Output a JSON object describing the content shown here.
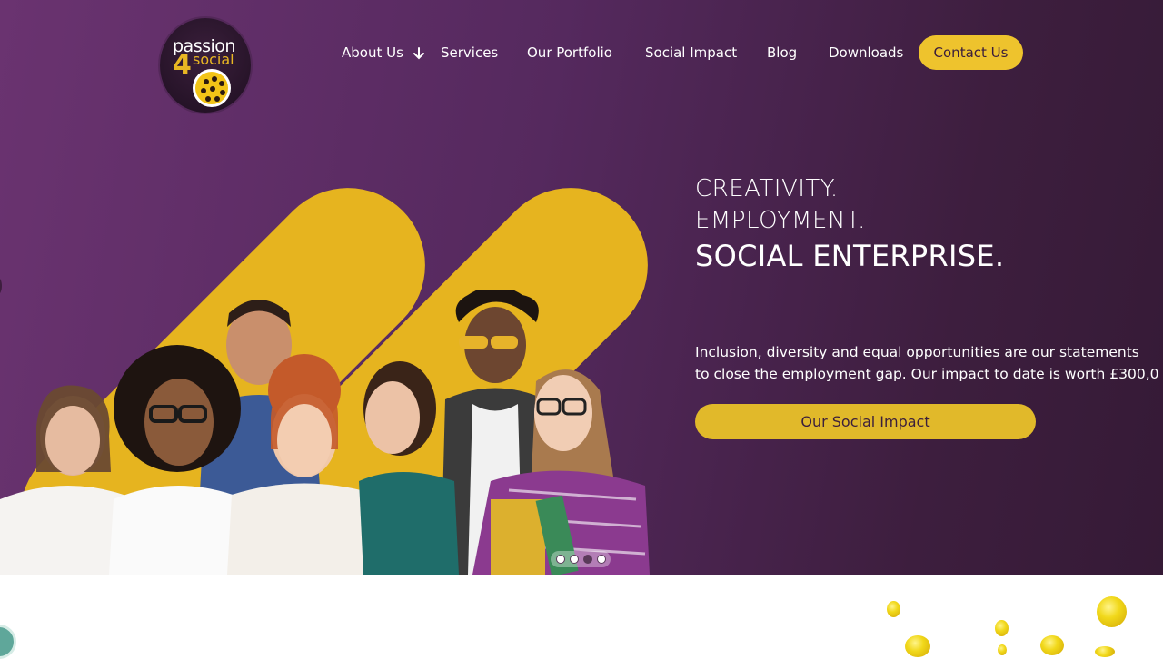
{
  "brand": {
    "logo_line1": "passion",
    "logo_number": "4",
    "logo_line2": "social"
  },
  "nav": {
    "items": [
      "About Us",
      "Services",
      "Our Portfolio",
      "Social Impact",
      "Blog",
      "Downloads"
    ],
    "cta": "Contact Us"
  },
  "hero": {
    "line1": "CREATIVITY.",
    "line2": "EMPLOYMENT.",
    "line3": "SOCIAL ENTERPRISE.",
    "description_line1": "Inclusion, diversity and equal opportunities are our statements",
    "description_line2": "to close the employment gap. Our impact to date is worth £300,0",
    "button": "Our Social Impact",
    "slide_count": 4,
    "active_slide": 3
  },
  "colors": {
    "accent": "#eec32d",
    "hero_purple": "#55295e",
    "hero_dark": "#351a36",
    "chat_green": "#5fa79a"
  }
}
